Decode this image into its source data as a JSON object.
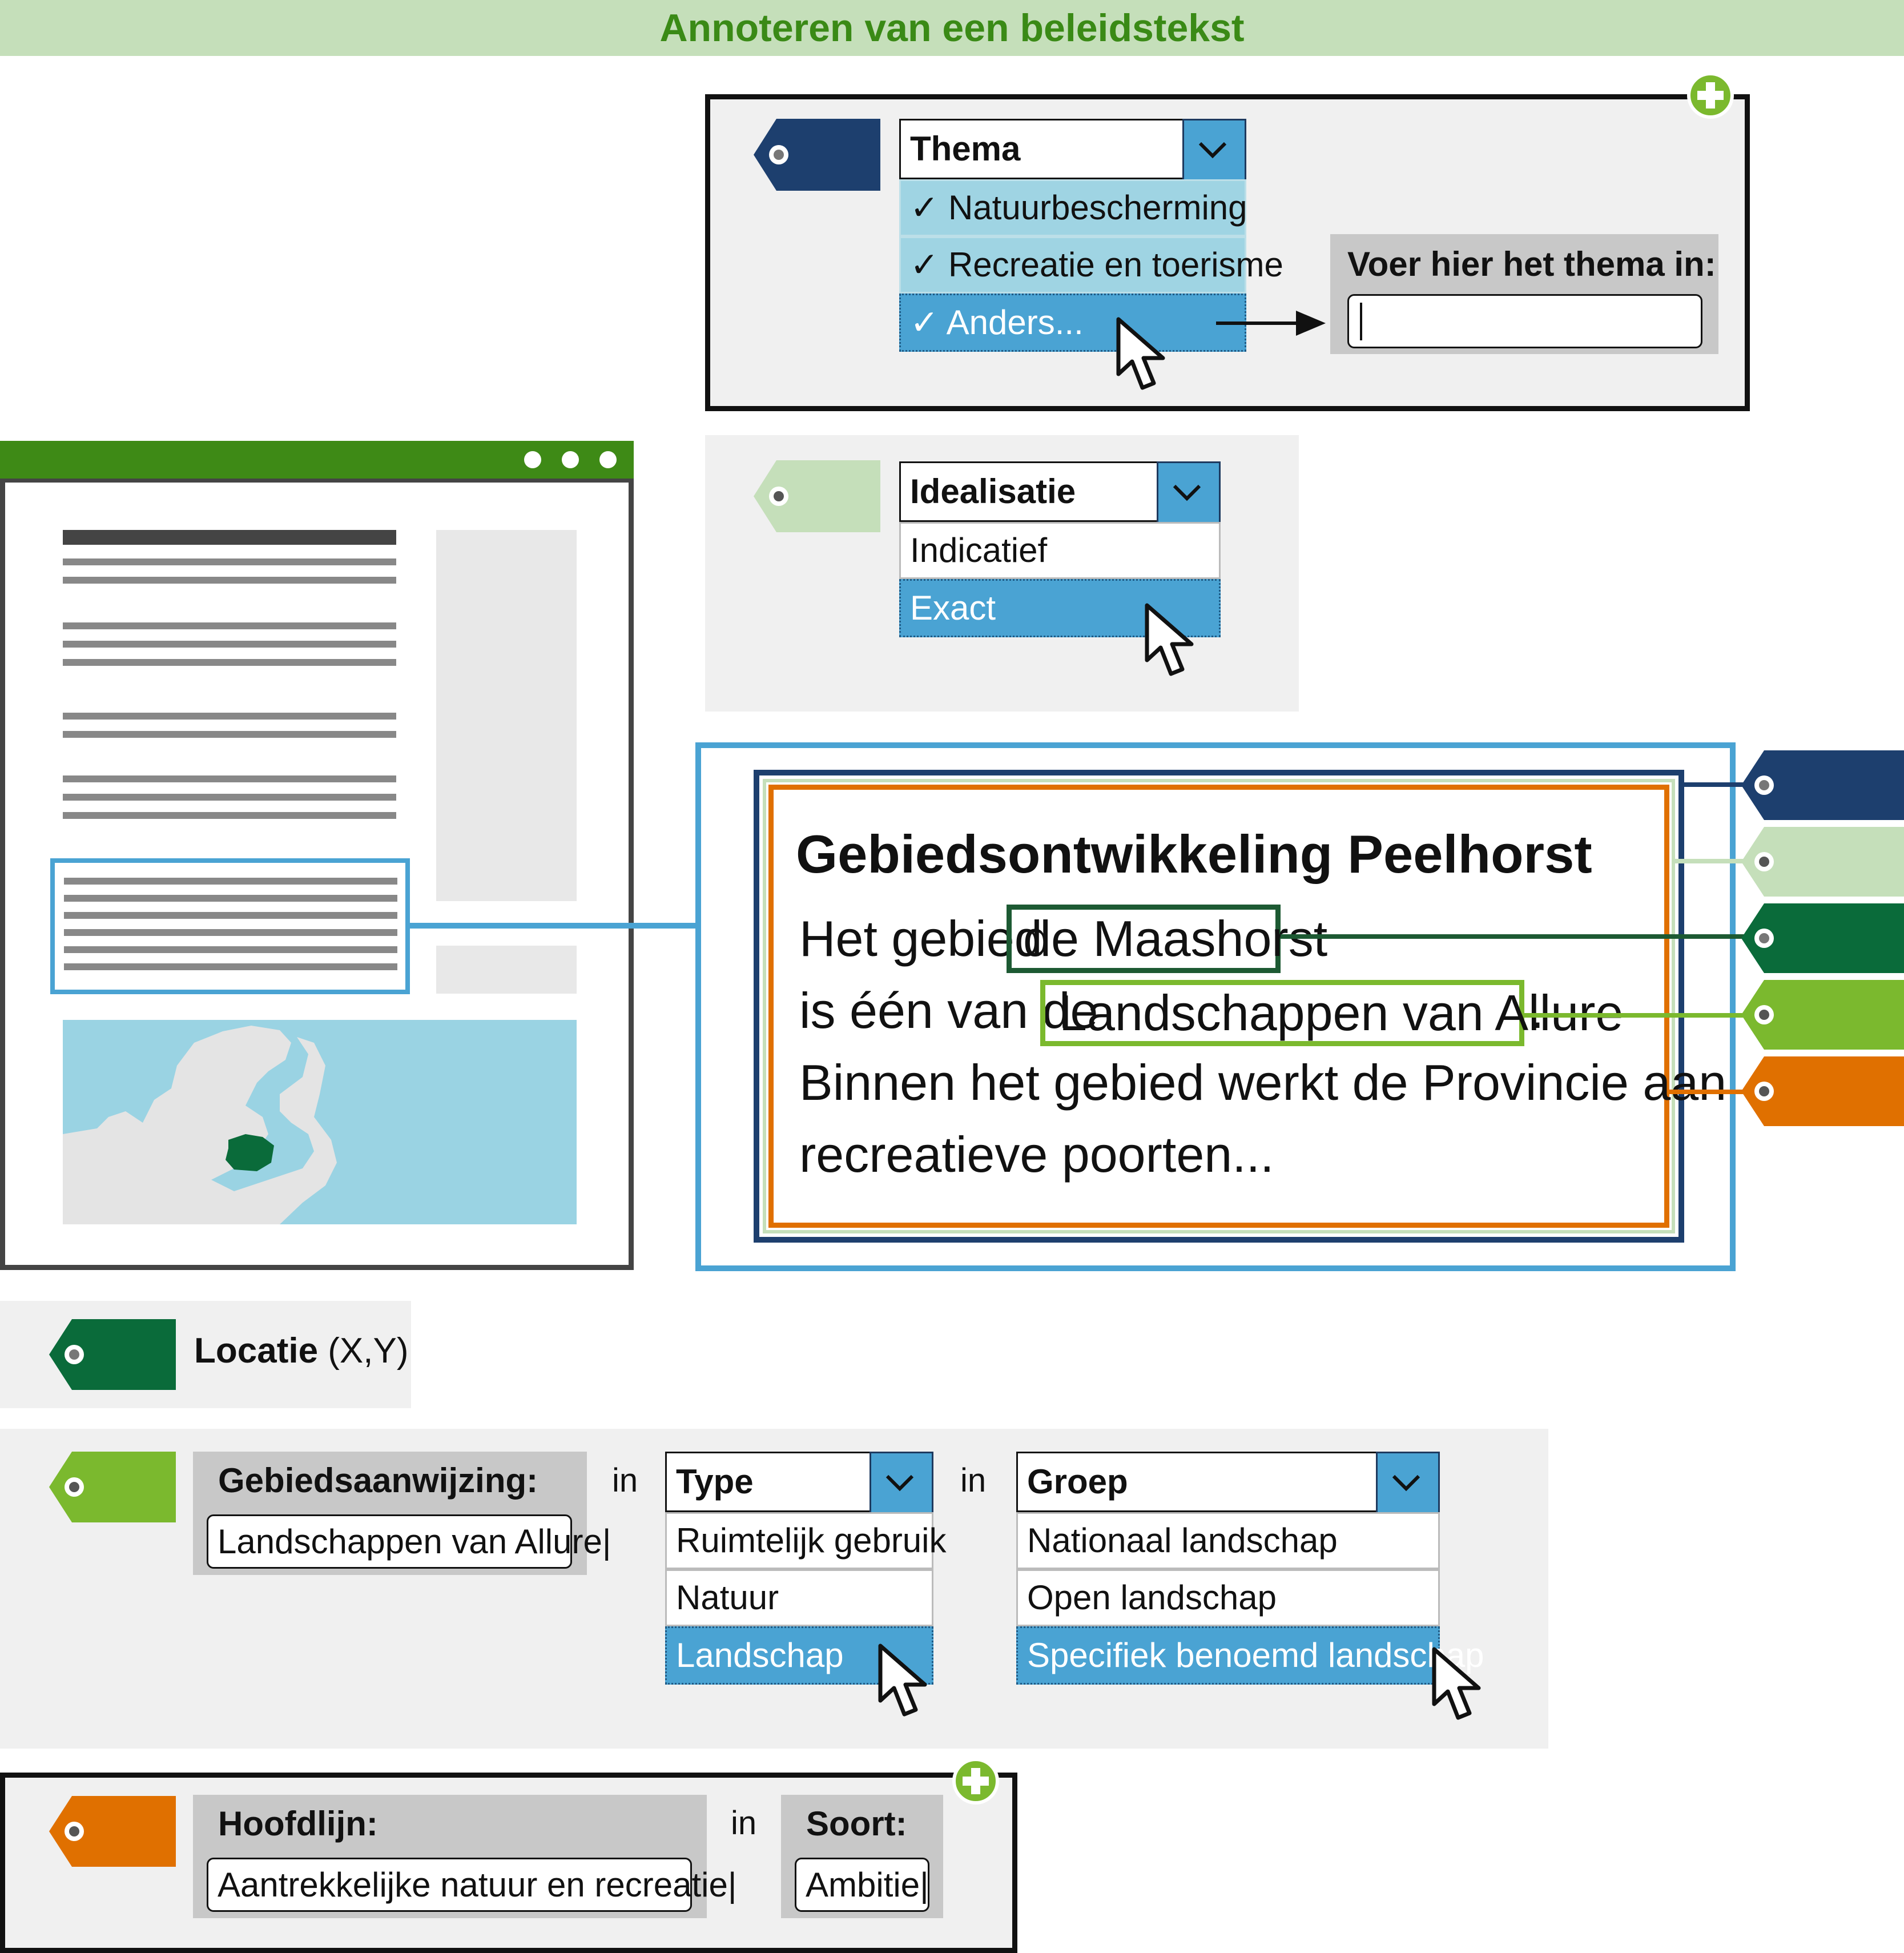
{
  "title": "Annoteren van een beleidstekst",
  "colors": {
    "dark_blue": "#1d3f6e",
    "light_green": "#c5dfba",
    "dark_green": "#0a6b3a",
    "lime_green": "#7bb92e",
    "orange": "#e07000",
    "light_blue": "#4aa3d3",
    "window_green": "#3e8a16"
  },
  "thema": {
    "dropdown_label": "Thema",
    "options": [
      "Natuurbescherming",
      "Recreatie en toerisme",
      "Anders..."
    ],
    "selected": "Anders...",
    "input_label": "Voer hier het thema in:",
    "input_value": "",
    "icons": [
      "tag-icon",
      "chevron-down-icon",
      "check-icon",
      "cursor-icon",
      "plus-icon",
      "arrow-right-icon"
    ]
  },
  "idealisatie": {
    "dropdown_label": "Idealisatie",
    "options": [
      "Indicatief",
      "Exact"
    ],
    "selected": "Exact"
  },
  "document": {
    "heading": "Gebiedsontwikkeling Peelhorst",
    "line1_pre": "Het gebied",
    "highlight1": "de Maashorst",
    "line2_pre": "is één van de",
    "highlight2": "Landschappen van Allure",
    "line2_post": ".",
    "line3": "Binnen het gebied werkt de Provincie aan",
    "line4": "recreatieve poorten..."
  },
  "locatie": {
    "label_bold": "Locatie",
    "label_rest": " (X,Y)"
  },
  "gebiedsaanwijzing": {
    "label": "Gebiedsaanwijzing:",
    "value": "Landschappen van Allure",
    "in1": "in",
    "type_label": "Type",
    "type_options": [
      "Ruimtelijk gebruik",
      "Natuur",
      "Landschap"
    ],
    "type_selected": "Landschap",
    "in2": "in",
    "groep_label": "Groep",
    "groep_options": [
      "Nationaal landschap",
      "Open landschap",
      "Specifiek benoemd landschap"
    ],
    "groep_selected": "Specifiek benoemd landschap"
  },
  "hoofdlijn": {
    "label": "Hoofdlijn:",
    "value": "Aantrekkelijke natuur en recreatie",
    "in": "in",
    "soort_label": "Soort:",
    "soort_value": "Ambitie"
  }
}
